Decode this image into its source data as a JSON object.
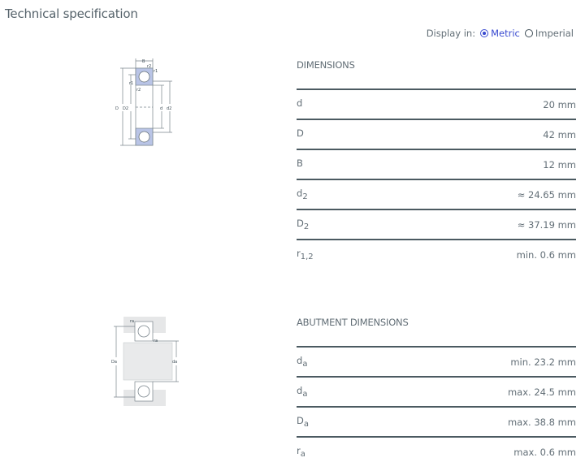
{
  "page": {
    "title": "Technical specification"
  },
  "display": {
    "label": "Display in:",
    "options": [
      {
        "label": "Metric",
        "selected": true
      },
      {
        "label": "Imperial",
        "selected": false
      }
    ]
  },
  "dimensions": {
    "title": "DIMENSIONS",
    "rows": [
      {
        "symbol": "d",
        "sub": "",
        "value": "20 mm"
      },
      {
        "symbol": "D",
        "sub": "",
        "value": "42 mm"
      },
      {
        "symbol": "B",
        "sub": "",
        "value": "12 mm"
      },
      {
        "symbol": "d",
        "sub": "2",
        "value": "≈ 24.65 mm"
      },
      {
        "symbol": "D",
        "sub": "2",
        "value": "≈ 37.19 mm"
      },
      {
        "symbol": "r",
        "sub": "1,2",
        "value": "min. 0.6 mm"
      }
    ],
    "drawing_labels": {
      "B": "B",
      "r2": "r2",
      "r1": "r1",
      "D": "D",
      "D2": "D2",
      "d": "d",
      "d2": "d2"
    }
  },
  "abutment": {
    "title": "ABUTMENT DIMENSIONS",
    "rows": [
      {
        "symbol": "d",
        "sub": "a",
        "value": "min. 23.2 mm"
      },
      {
        "symbol": "d",
        "sub": "a",
        "value": "max. 24.5 mm"
      },
      {
        "symbol": "D",
        "sub": "a",
        "value": "max. 38.8 mm"
      },
      {
        "symbol": "r",
        "sub": "a",
        "value": "max. 0.6 mm"
      }
    ],
    "drawing_labels": {
      "ra": "ra",
      "Da": "Da",
      "da": "da"
    }
  },
  "colors": {
    "accent": "#3a4bd0",
    "text": "#626e76",
    "rule": "#4b5a61",
    "bearing_fill": "#b9c4e6"
  }
}
